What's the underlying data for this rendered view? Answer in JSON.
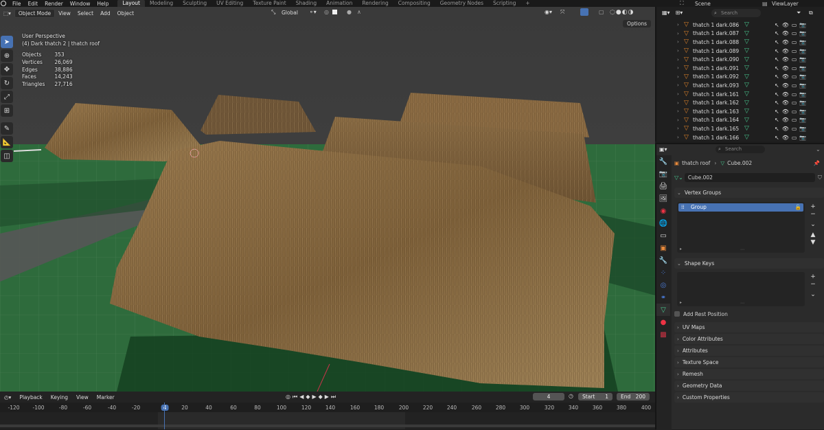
{
  "topbar": {
    "menus": [
      "File",
      "Edit",
      "Render",
      "Window",
      "Help"
    ],
    "workspaces": [
      "Layout",
      "Modeling",
      "Sculpting",
      "UV Editing",
      "Texture Paint",
      "Shading",
      "Animation",
      "Rendering",
      "Compositing",
      "Geometry Nodes",
      "Scripting"
    ],
    "active_workspace": "Layout",
    "add_workspace": "+",
    "scene": "Scene",
    "view_layer": "ViewLayer"
  },
  "viewport": {
    "mode": "Object Mode",
    "menus": [
      "View",
      "Select",
      "Add",
      "Object"
    ],
    "orientation": "Global",
    "options_label": "Options",
    "perspective": "User Perspective",
    "context": "(4) Dark thatch 2 | thatch roof",
    "stats": [
      {
        "label": "Objects",
        "value": "353"
      },
      {
        "label": "Vertices",
        "value": "26,069"
      },
      {
        "label": "Edges",
        "value": "38,886"
      },
      {
        "label": "Faces",
        "value": "14,243"
      },
      {
        "label": "Triangles",
        "value": "27,716"
      }
    ]
  },
  "timeline": {
    "menus": [
      "Playback",
      "Keying",
      "View",
      "Marker"
    ],
    "current_frame": "4",
    "start_label": "Start",
    "start": "1",
    "end_label": "End",
    "end": "200",
    "ruler": [
      "-120",
      "-100",
      "-80",
      "-60",
      "-40",
      "-20",
      "4",
      "20",
      "40",
      "60",
      "80",
      "100",
      "120",
      "140",
      "160",
      "180",
      "200",
      "220",
      "240",
      "260",
      "280",
      "300",
      "320",
      "340",
      "360",
      "380",
      "400"
    ]
  },
  "outliner": {
    "search_placeholder": "Search",
    "items": [
      "thatch 1 dark.086",
      "thatch 1 dark.087",
      "thatch 1 dark.088",
      "thatch 1 dark.089",
      "thatch 1 dark.090",
      "thatch 1 dark.091",
      "thatch 1 dark.092",
      "thatch 1 dark.093",
      "thatch 1 dark.161",
      "thatch 1 dark.162",
      "thatch 1 dark.163",
      "thatch 1 dark.164",
      "thatch 1 dark.165",
      "thatch 1 dark.166"
    ]
  },
  "properties": {
    "search_placeholder": "Search",
    "breadcrumb": [
      "thatch roof",
      "Cube.002"
    ],
    "mesh_name": "Cube.002",
    "vertex_groups_title": "Vertex Groups",
    "vertex_group_items": [
      "Group"
    ],
    "shape_keys_title": "Shape Keys",
    "add_rest_position": "Add Rest Position",
    "collapsed_panels": [
      "UV Maps",
      "Color Attributes",
      "Attributes",
      "Texture Space",
      "Remesh",
      "Geometry Data",
      "Custom Properties"
    ]
  },
  "colors": {
    "accent": "#4772b3",
    "mesh_icon": "#e0842a",
    "data_icon": "#48c88f",
    "playhead": "#4772b3"
  }
}
